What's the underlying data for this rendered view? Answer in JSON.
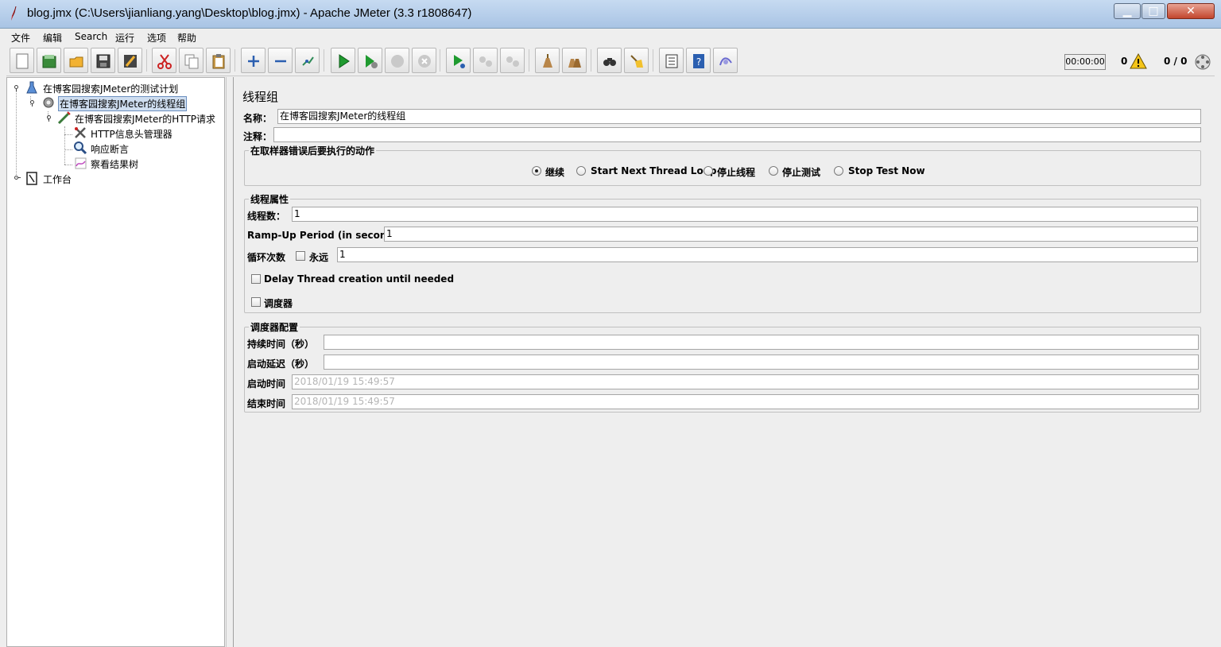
{
  "window": {
    "title": "blog.jmx (C:\\Users\\jianliang.yang\\Desktop\\blog.jmx) - Apache JMeter (3.3 r1808647)"
  },
  "menu": [
    "文件",
    "编辑",
    "Search",
    "运行",
    "选项",
    "帮助"
  ],
  "toolbar": {
    "buttons": [
      "new-icon",
      "templates-icon",
      "open-icon",
      "save-icon",
      "save-as-icon",
      "cut-icon",
      "copy-icon",
      "paste-icon",
      "expand-icon",
      "collapse-icon",
      "toggle-icon",
      "start-icon",
      "start-no-pause-icon",
      "stop-icon",
      "shutdown-icon",
      "remote-start-icon",
      "remote-stop-icon",
      "remote-shutdown-icon",
      "clear-icon",
      "clear-all-icon",
      "search-icon",
      "reset-search-icon",
      "function-helper-icon",
      "help-icon",
      "logger-icon"
    ],
    "timer": "00:00:00",
    "error_count": "0",
    "thread_count": "0 / 0"
  },
  "tree": {
    "nodes": [
      {
        "label": "在博客园搜索JMeter的测试计划",
        "icon": "test-plan-icon"
      },
      {
        "label": "在博客园搜索JMeter的线程组",
        "icon": "thread-group-icon"
      },
      {
        "label": "在博客园搜索JMeter的HTTP请求",
        "icon": "http-sampler-icon"
      },
      {
        "label": "HTTP信息头管理器",
        "icon": "header-manager-icon"
      },
      {
        "label": "响应断言",
        "icon": "assertion-icon"
      },
      {
        "label": "察看结果树",
        "icon": "results-tree-icon"
      },
      {
        "label": "工作台",
        "icon": "workbench-icon"
      }
    ]
  },
  "panel": {
    "title": "线程组",
    "name_label": "名称：",
    "name_value": "在博客园搜索JMeter的线程组",
    "comment_label": "注释：",
    "comment_value": "",
    "error_action": {
      "title": "在取样器错误后要执行的动作",
      "options": [
        "继续",
        "Start Next Thread Loop",
        "停止线程",
        "停止测试",
        "Stop Test Now"
      ],
      "selected": "继续"
    },
    "thread_props": {
      "title": "线程属性",
      "threads_label": "线程数：",
      "threads_value": "1",
      "rampup_label": "Ramp-Up Period (in seconds):",
      "rampup_value": "1",
      "loop_label": "循环次数",
      "forever_label": "永远",
      "forever_checked": false,
      "loop_value": "1",
      "delay_label": "Delay Thread creation until needed",
      "delay_checked": false,
      "scheduler_label": "调度器",
      "scheduler_checked": false
    },
    "scheduler": {
      "title": "调度器配置",
      "duration_label": "持续时间（秒）",
      "duration_value": "",
      "startup_delay_label": "启动延迟（秒）",
      "startup_delay_value": "",
      "start_time_label": "启动时间",
      "start_time_value": "2018/01/19 15:49:57",
      "end_time_label": "结束时间",
      "end_time_value": "2018/01/19 15:49:57"
    }
  }
}
